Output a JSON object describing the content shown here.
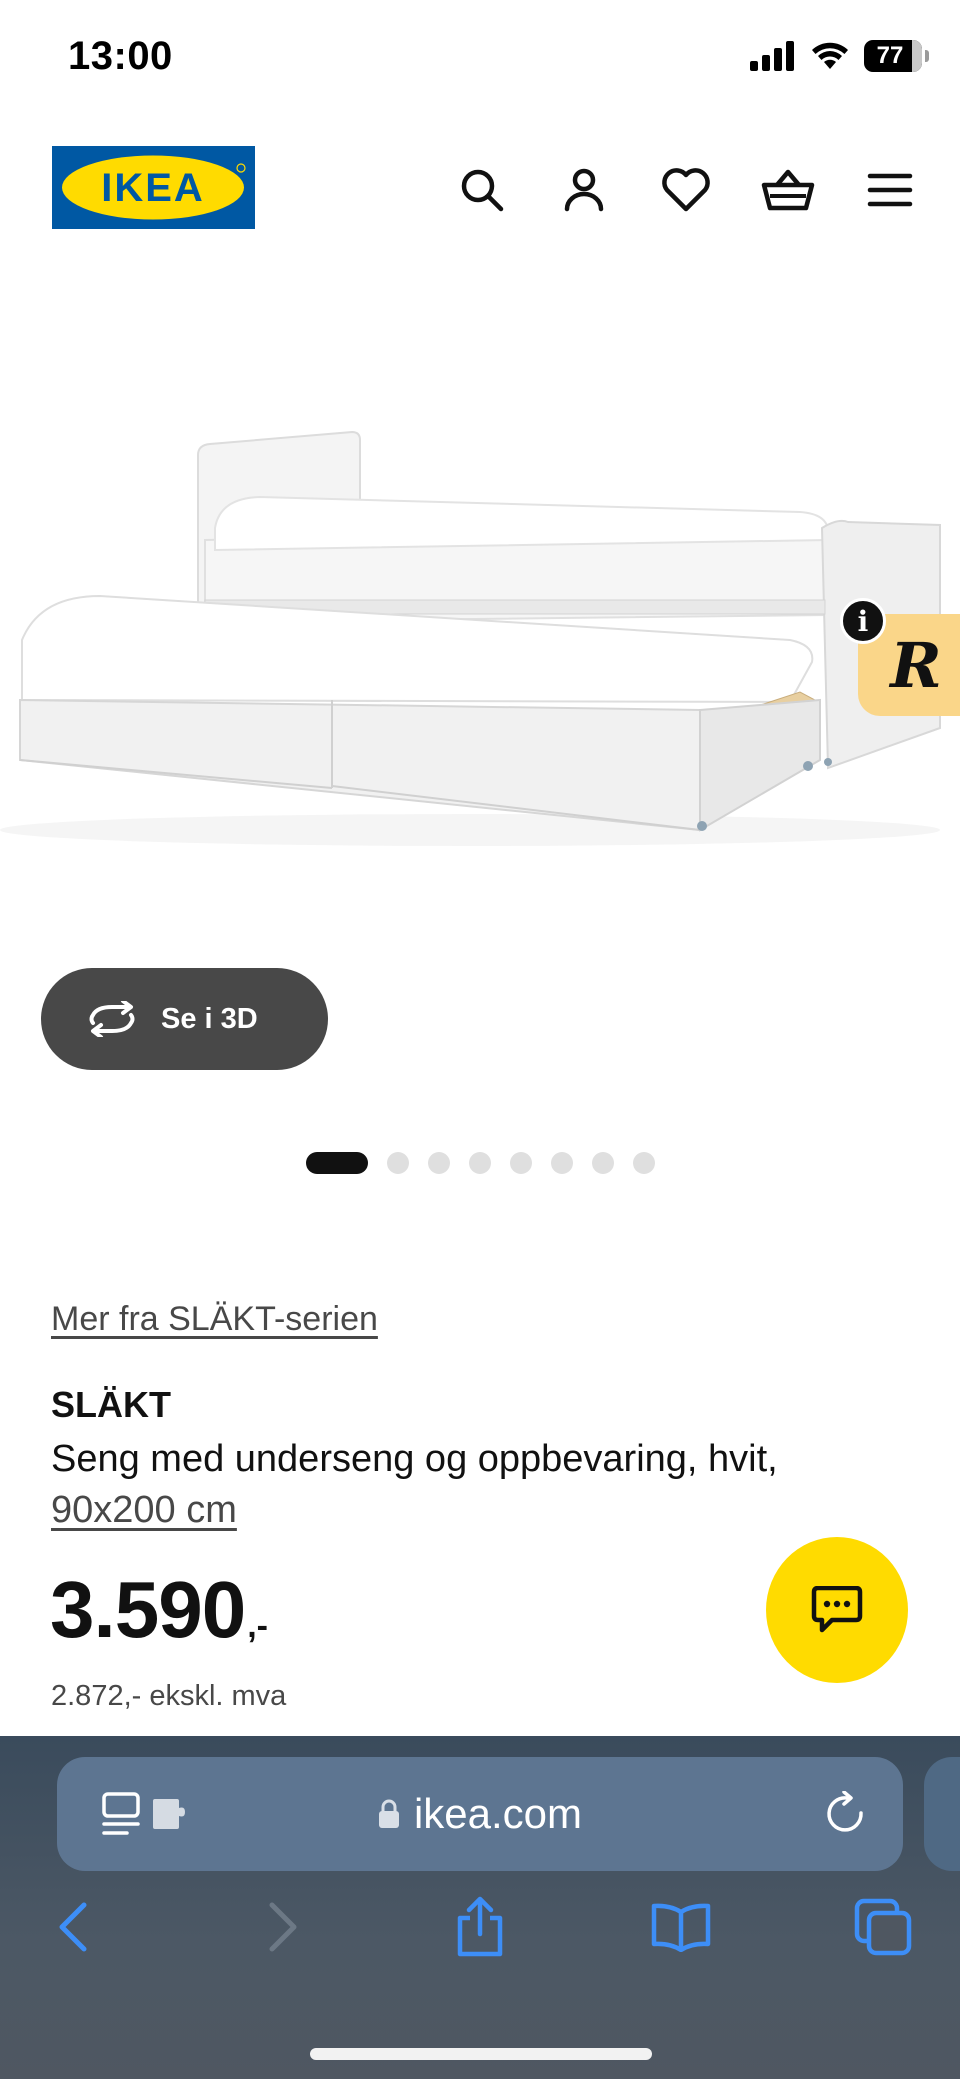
{
  "status_bar": {
    "time": "13:00",
    "battery": "77"
  },
  "header": {
    "logo_text": "IKEA",
    "icons": [
      "search-icon",
      "account-icon",
      "heart-icon",
      "basket-icon",
      "menu-icon"
    ]
  },
  "gallery": {
    "view_3d_label": "Se i 3D",
    "dots_total": 8,
    "active_dot": 1
  },
  "product": {
    "series_link": "Mer fra SLÄKT-serien",
    "name": "SLÄKT",
    "description": "Seng med underseng og oppbevaring, hvit,",
    "size": "90x200 cm",
    "price_main": "3.590",
    "price_suffix": ",-",
    "price_excl_vat": "2.872,- ekskl. mva"
  },
  "browser": {
    "url": "ikea.com",
    "icons": [
      "reader-icon",
      "extension-icon",
      "lock-icon",
      "reload-icon",
      "back-icon",
      "forward-icon",
      "share-icon",
      "bookmarks-icon",
      "tabs-icon"
    ]
  },
  "colors": {
    "ikea_blue": "#0058a3",
    "ikea_yellow": "#ffdb00",
    "safari_blue": "#3d8ef7"
  }
}
